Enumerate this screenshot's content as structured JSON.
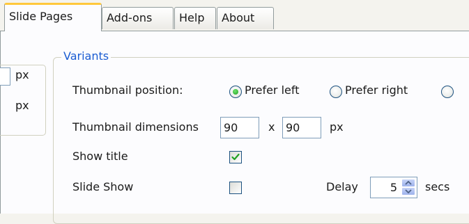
{
  "tabs": [
    {
      "label": "Slide Pages",
      "active": true
    },
    {
      "label": "Add-ons",
      "active": false
    },
    {
      "label": "Help",
      "active": false
    },
    {
      "label": "About",
      "active": false
    }
  ],
  "left_group": {
    "unit_1": "px",
    "unit_2": "px"
  },
  "variants": {
    "legend": "Variants",
    "thumbnail_position": {
      "label": "Thumbnail position:",
      "options": [
        {
          "label": "Prefer left",
          "selected": true
        },
        {
          "label": "Prefer right",
          "selected": false
        }
      ]
    },
    "thumbnail_dimensions": {
      "label": "Thumbnail dimensions",
      "width": "90",
      "separator": "x",
      "height": "90",
      "unit": "px"
    },
    "show_title": {
      "label": "Show title",
      "checked": true
    },
    "slide_show": {
      "label": "Slide Show",
      "checked": false,
      "delay_label": "Delay",
      "delay_value": "5",
      "delay_unit": "secs"
    }
  },
  "icons": [
    "radio-selected",
    "radio-unselected",
    "check-icon",
    "spinner-up-icon",
    "spinner-down-icon"
  ],
  "colors": {
    "legend": "#1a5cd2",
    "tab_highlight": "#ffc83c",
    "radio_dot": "#21a121",
    "check": "#21a121",
    "spinner": "#9db2ec"
  }
}
